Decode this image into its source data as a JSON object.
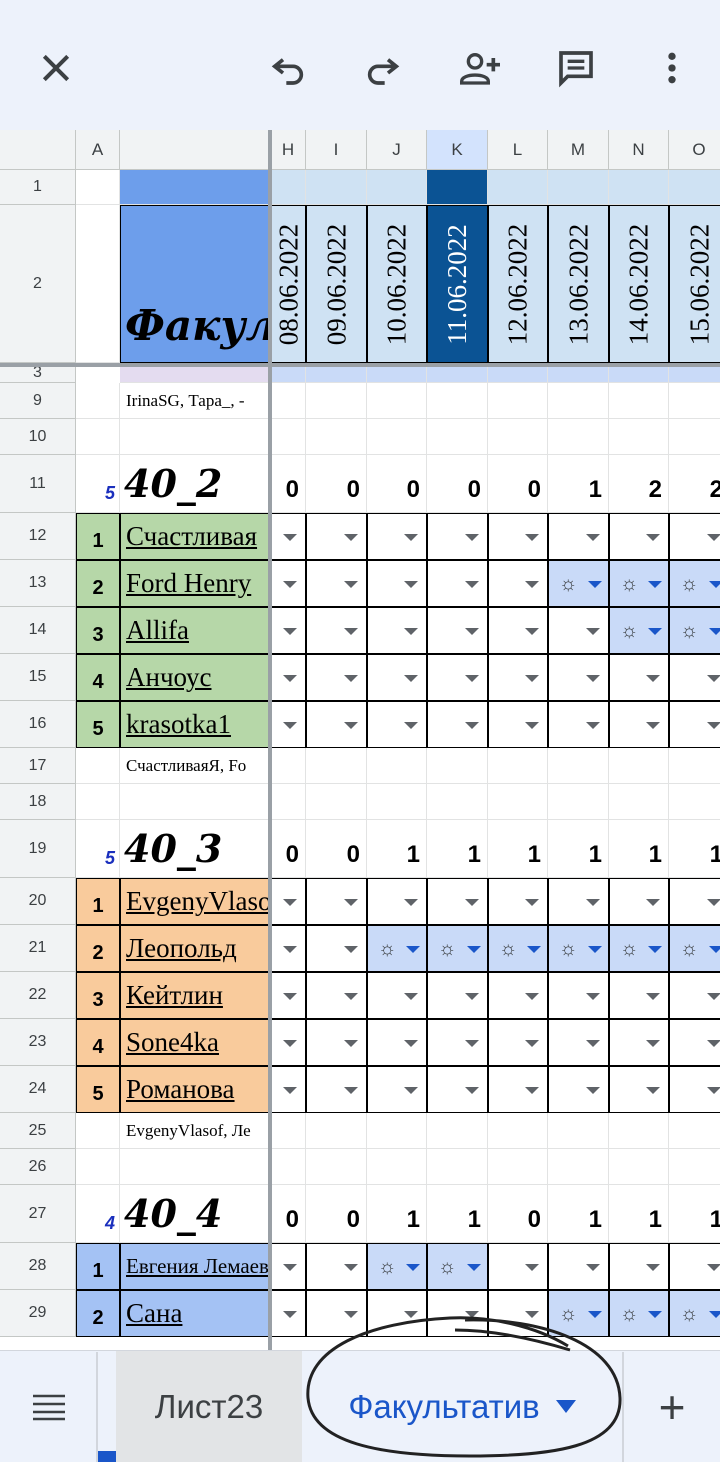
{
  "colors": {
    "header_blue": "#6d9eeb",
    "date_blue": "#cfe2f3",
    "selected": "#0b5394",
    "green": "#b6d7a8",
    "orange": "#f9cb9c",
    "blue_group": "#a4c2f4",
    "sun_cell": "#c9daf8",
    "accent": "#1a56c9"
  },
  "toolbar": {
    "icons": [
      "close-icon",
      "undo-icon",
      "redo-icon",
      "add-person-icon",
      "comment-icon",
      "more-vert-icon"
    ]
  },
  "columns": {
    "A": "A",
    "H": "H",
    "I": "I",
    "J": "J",
    "K": "K",
    "L": "L",
    "M": "M",
    "N": "N",
    "O": "O"
  },
  "header_cell": "Факул",
  "dates": [
    "08.06.2022",
    "09.06.2022",
    "10.06.2022",
    "11.06.2022",
    "12.06.2022",
    "13.06.2022",
    "14.06.2022",
    "15.06.2022"
  ],
  "rows": {
    "r1": "1",
    "r2": "2",
    "r9": "9",
    "r10": "10",
    "r11": "11",
    "r12": "12",
    "r13": "13",
    "r14": "14",
    "r15": "15",
    "r16": "16",
    "r17": "17",
    "r18": "18",
    "r19": "19",
    "r20": "20",
    "r21": "21",
    "r22": "22",
    "r23": "23",
    "r24": "24",
    "r25": "25",
    "r26": "26",
    "r27": "27",
    "r28": "28",
    "r29": "29"
  },
  "partial_row_label": "3",
  "note_top": "IrinaSG, Тара_, -",
  "groups": [
    {
      "title": "40_2",
      "count": "5",
      "sums": [
        "0",
        "0",
        "0",
        "0",
        "0",
        "1",
        "2",
        "2"
      ],
      "members": [
        {
          "idx": "1",
          "name": "Счастливая"
        },
        {
          "idx": "2",
          "name": "Ford Henry"
        },
        {
          "idx": "3",
          "name": "Allifa"
        },
        {
          "idx": "4",
          "name": "Анчоус"
        },
        {
          "idx": "5",
          "name": "krasotka1"
        }
      ],
      "note": "СчастливаяЯ, Fo"
    },
    {
      "title": "40_3",
      "count": "5",
      "sums": [
        "0",
        "0",
        "1",
        "1",
        "1",
        "1",
        "1",
        "1"
      ],
      "members": [
        {
          "idx": "1",
          "name": "EvgenyVlasof"
        },
        {
          "idx": "2",
          "name": "Леопольд"
        },
        {
          "idx": "3",
          "name": "Кейтлин"
        },
        {
          "idx": "4",
          "name": "Sone4ka"
        },
        {
          "idx": "5",
          "name": "Романова"
        }
      ],
      "note": "EvgenyVlasof, Ле"
    },
    {
      "title": "40_4",
      "count": "4",
      "sums": [
        "0",
        "0",
        "1",
        "1",
        "0",
        "1",
        "1",
        "1"
      ],
      "members": [
        {
          "idx": "1",
          "name": "Евгения Лемаева"
        },
        {
          "idx": "2",
          "name": "Сана"
        }
      ]
    }
  ],
  "sun_symbol": "☼",
  "tabs": {
    "menu_icon": "menu-icon",
    "sheet1": "Лист23",
    "sheet2": "Факультатив",
    "add": "+"
  }
}
